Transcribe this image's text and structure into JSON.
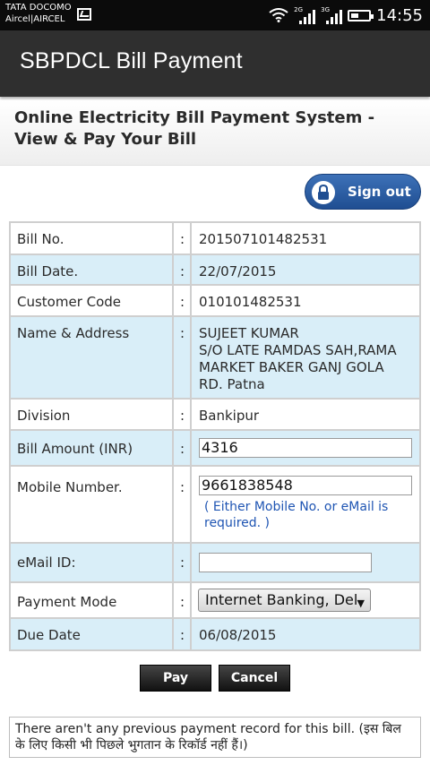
{
  "status_bar": {
    "carrier_1": "TATA DOCOMO",
    "carrier_2": "Aircel|AIRCEL",
    "net_1": "2G",
    "net_2": "3G",
    "time": "14:55"
  },
  "app_bar": {
    "title": "SBPDCL Bill Payment"
  },
  "page": {
    "title": "Online Electricity Bill Payment System - View & Pay Your Bill"
  },
  "signout": {
    "label": "Sign out"
  },
  "bill": {
    "separator": ":",
    "bill_no_label": "Bill No.",
    "bill_no": "201507101482531",
    "bill_date_label": "Bill Date.",
    "bill_date": "22/07/2015",
    "customer_code_label": "Customer Code",
    "customer_code": "010101482531",
    "name_address_label": "Name & Address",
    "name_line_1": "SUJEET KUMAR",
    "name_line_2": "S/O LATE RAMDAS SAH,RAMA",
    "name_line_3": "MARKET BAKER GANJ GOLA",
    "name_line_4": "RD. Patna",
    "division_label": "Division",
    "division": "Bankipur",
    "amount_label": "Bill Amount (INR)",
    "amount": "4316",
    "mobile_label": "Mobile Number.",
    "mobile": "9661838548",
    "mobile_hint": "( Either Mobile No. or eMail is required. )",
    "email_label": "eMail ID:",
    "email": "",
    "payment_mode_label": "Payment Mode",
    "payment_mode": "Internet Banking, Del",
    "due_date_label": "Due Date",
    "due_date": "06/08/2015"
  },
  "actions": {
    "pay": "Pay",
    "cancel": "Cancel"
  },
  "message": "There aren't any previous payment record for this bill. (इस बिल के लिए किसी भी पिछले भुगतान के रिकॉर्ड नहीं हैं।)"
}
